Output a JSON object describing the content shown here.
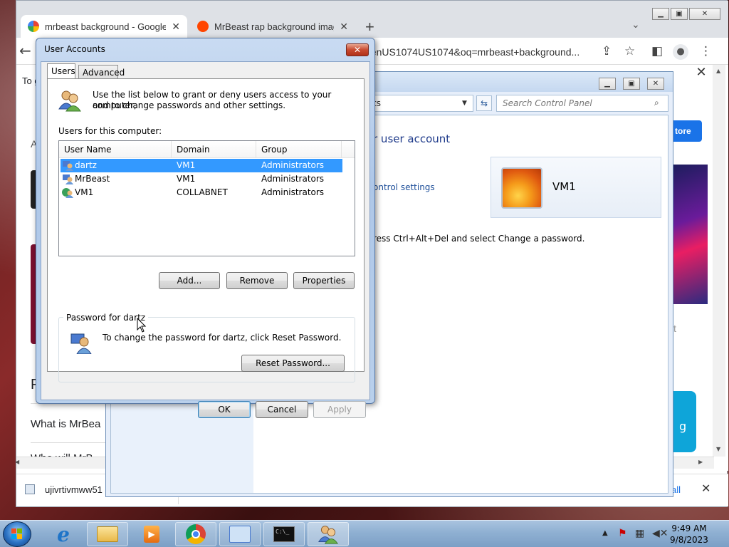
{
  "chrome": {
    "tabs": [
      {
        "title": "mrbeast background - Google Se",
        "active": true
      },
      {
        "title": "MrBeast rap background image",
        "active": false
      }
    ],
    "omnibox": "_enUS1074US1074&oq=mrbeast+background...",
    "page": {
      "prefix_to": "To g",
      "prefix_a": "A",
      "letter_p": "P",
      "question1": "What is MrBea",
      "question2": "Who will MrB",
      "store_button": "tore",
      "side_text_t": "t",
      "side_text_g": "g",
      "download_file": "ujivrtivmww51",
      "show_all": "all"
    }
  },
  "control_panel": {
    "address": "ts",
    "search_placeholder": "Search Control Panel",
    "heading": "r user account",
    "link": "ontrol settings",
    "note": "ress Ctrl+Alt+Del and select Change a password.",
    "account_name": "VM1"
  },
  "user_accounts": {
    "title": "User Accounts",
    "tabs": [
      "Users",
      "Advanced"
    ],
    "intro_line1": "Use the list below to grant or deny users access to your computer,",
    "intro_line2": "and to change passwords and other settings.",
    "users_label": "Users for this computer:",
    "columns": [
      "User Name",
      "Domain",
      "Group"
    ],
    "users": [
      {
        "name": "dartz",
        "domain": "VM1",
        "group": "Administrators",
        "selected": true
      },
      {
        "name": "MrBeast",
        "domain": "VM1",
        "group": "Administrators",
        "selected": false
      },
      {
        "name": "VM1",
        "domain": "COLLABNET",
        "group": "Administrators",
        "selected": false
      }
    ],
    "buttons": {
      "add": "Add...",
      "remove": "Remove",
      "properties": "Properties",
      "reset": "Reset Password...",
      "ok": "OK",
      "cancel": "Cancel",
      "apply": "Apply"
    },
    "password_group_label": "Password for dartz",
    "password_text": "To change the password for dartz, click Reset Password."
  },
  "taskbar": {
    "time": "9:49 AM",
    "date": "9/8/2023"
  }
}
